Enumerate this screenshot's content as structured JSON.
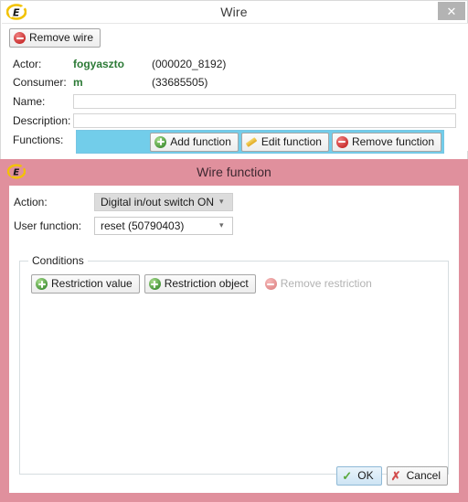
{
  "wire_window": {
    "title": "Wire",
    "logo_icon": "app-logo-e-icon",
    "close_icon": "close-icon",
    "close_label": "✕",
    "toolbar": {
      "remove_wire_label": "Remove wire",
      "remove_wire_icon": "minus-circle-red-icon"
    },
    "fields": {
      "actor_label": "Actor:",
      "actor_value": "fogyaszto",
      "actor_id": "(000020_8192)",
      "consumer_label": "Consumer:",
      "consumer_value": "m",
      "consumer_id": "(33685505)",
      "name_label": "Name:",
      "name_value": "",
      "name_placeholder": "",
      "description_label": "Description:",
      "description_value": "",
      "description_placeholder": "",
      "functions_label": "Functions:"
    },
    "function_buttons": {
      "add_label": "Add function",
      "add_icon": "plus-circle-green-icon",
      "edit_label": "Edit function",
      "edit_icon": "pencil-icon",
      "remove_label": "Remove function",
      "remove_icon": "minus-circle-red-icon"
    }
  },
  "wire_function_dialog": {
    "title": "Wire function",
    "logo_icon": "app-logo-e-icon",
    "action_label": "Action:",
    "action_value": "Digital in/out switch ON",
    "action_caret_icon": "chevron-down-icon",
    "user_function_label": "User function:",
    "user_function_value": "reset (50790403)",
    "user_function_caret_icon": "chevron-down-icon",
    "conditions": {
      "group_title": "Conditions",
      "restriction_value_label": "Restriction value",
      "restriction_value_icon": "plus-circle-green-icon",
      "restriction_object_label": "Restriction object",
      "restriction_object_icon": "plus-circle-green-icon",
      "remove_restriction_label": "Remove restriction",
      "remove_restriction_icon": "minus-circle-red-icon"
    },
    "footer": {
      "ok_label": "OK",
      "ok_icon": "check-green-icon",
      "cancel_label": "Cancel",
      "cancel_icon": "x-red-icon"
    }
  },
  "colors": {
    "dialog_accent_pink": "#e0909d",
    "selection_cyan": "#72cdea",
    "value_green": "#2c7a36",
    "close_button_gray": "#b3b3b3"
  }
}
